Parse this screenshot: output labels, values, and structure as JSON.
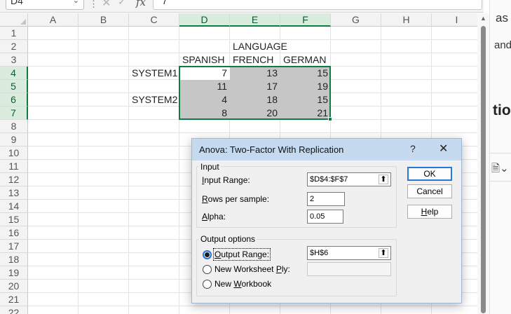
{
  "formula_bar": {
    "name_box": "D4",
    "cancel_glyph": "✕",
    "enter_glyph": "✓",
    "fx_label": "fx",
    "content": "7"
  },
  "grid": {
    "columns": [
      "A",
      "B",
      "C",
      "D",
      "E",
      "F",
      "G",
      "H",
      "I"
    ],
    "rows": [
      "1",
      "2",
      "3",
      "4",
      "5",
      "6",
      "7",
      "8",
      "9",
      "10",
      "11",
      "12",
      "13",
      "14",
      "15",
      "16",
      "17",
      "18",
      "19",
      "20",
      "21",
      "22"
    ],
    "selected_columns": [
      "D",
      "E",
      "F"
    ],
    "selected_rows": [
      "4",
      "5",
      "6",
      "7"
    ],
    "cells": {
      "E2": "LANGUAGE",
      "D3": "SPANISH",
      "E3": "FRENCH",
      "F3": "GERMAN",
      "C4": "SYSTEM1",
      "C6": "SYSTEM2",
      "D4": "7",
      "E4": "13",
      "F4": "15",
      "D5": "11",
      "E5": "17",
      "F5": "19",
      "D6": "4",
      "E6": "18",
      "F6": "15",
      "D7": "8",
      "E7": "20",
      "F7": "21"
    },
    "accent_color": "#107c41"
  },
  "side_panel": {
    "text1": "as",
    "text2": "and",
    "text3": "tio",
    "icon": "document-chevron-icon"
  },
  "dialog": {
    "title": "Anova: Two-Factor With Replication",
    "help_glyph": "?",
    "close_glyph": "✕",
    "input_group": "Input",
    "input_range_label": "Input Range:",
    "input_range_value": "$D$4:$F$7",
    "rows_per_sample_label": "Rows per sample:",
    "rows_per_sample_value": "2",
    "alpha_label": "Alpha:",
    "alpha_value": "0.05",
    "output_group": "Output options",
    "output_range_label": "Output Range:",
    "output_range_value": "$H$6",
    "new_worksheet_label": "New Worksheet Ply:",
    "new_worksheet_value": "",
    "new_workbook_label": "New Workbook",
    "selected_option": "Output Range",
    "ok_label": "OK",
    "cancel_label": "Cancel",
    "help_label": "Help",
    "title_bar_color": "#c5d9ef"
  }
}
